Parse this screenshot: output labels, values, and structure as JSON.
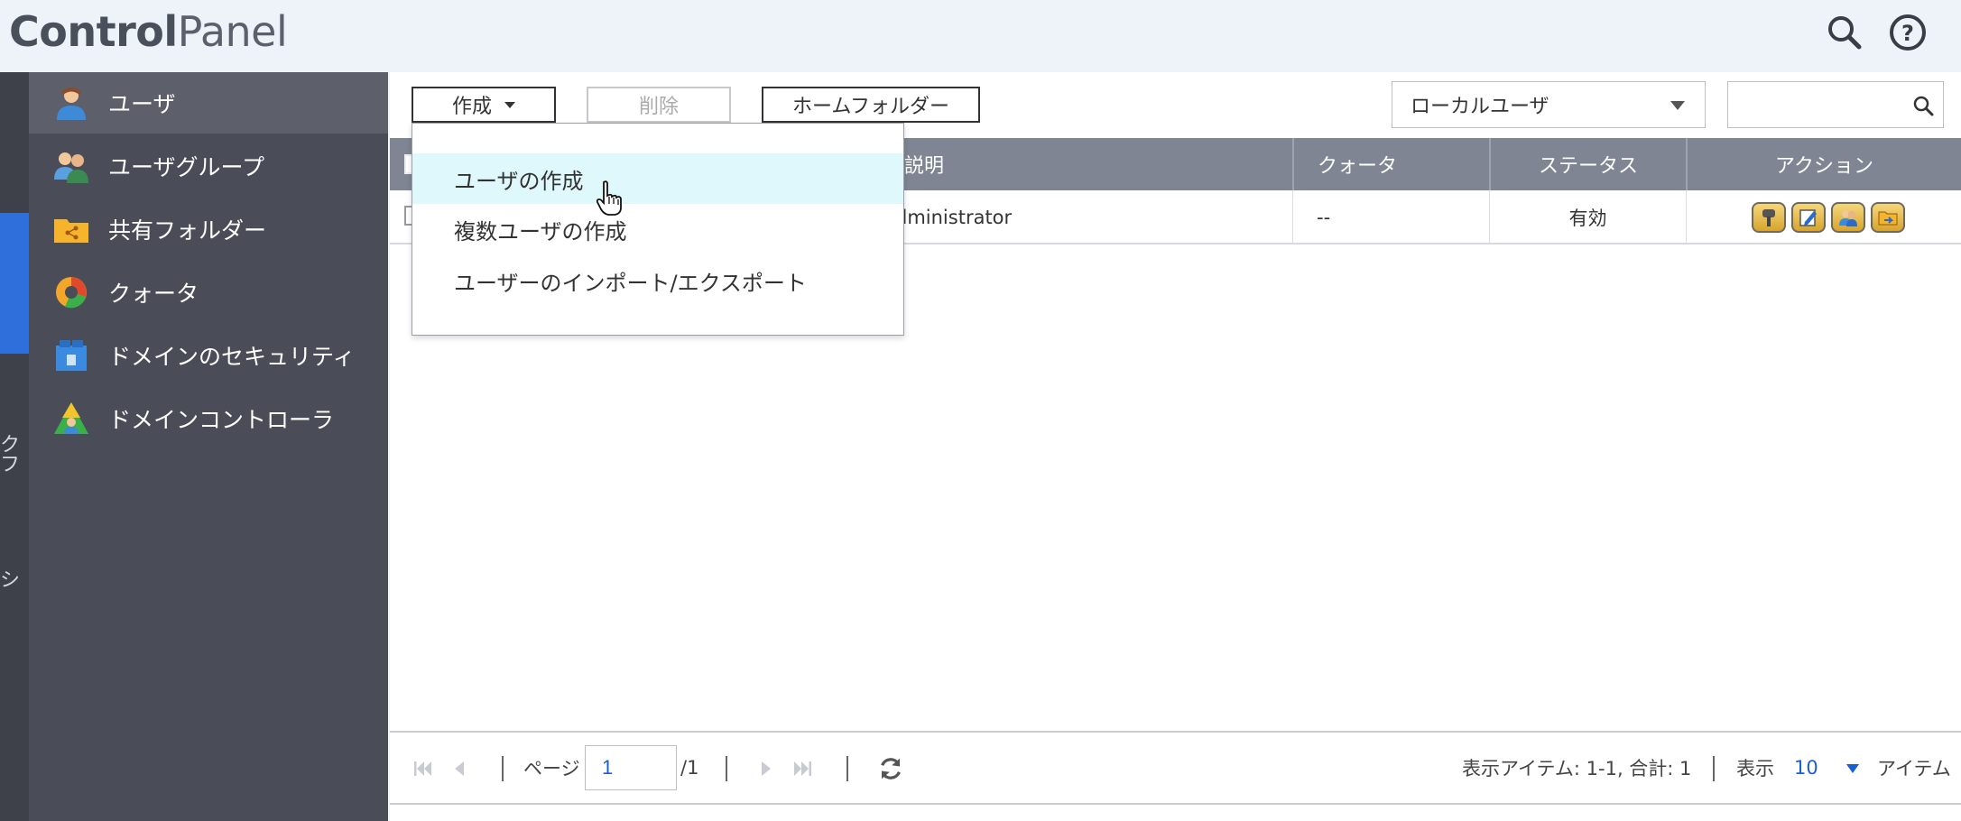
{
  "header": {
    "title_bold": "Control",
    "title_light": "Panel",
    "search_icon": "search-icon",
    "help_icon": "help-icon"
  },
  "rail": {
    "texts": [
      "ク",
      "フ",
      "シ"
    ]
  },
  "sidebar": {
    "items": [
      {
        "label": "ユーザ",
        "icon": "user-icon",
        "active": true
      },
      {
        "label": "ユーザグループ",
        "icon": "user-group-icon",
        "active": false
      },
      {
        "label": "共有フォルダー",
        "icon": "shared-folder-icon",
        "active": false
      },
      {
        "label": "クォータ",
        "icon": "quota-icon",
        "active": false
      },
      {
        "label": "ドメインのセキュリティ",
        "icon": "domain-security-icon",
        "active": false
      },
      {
        "label": "ドメインコントローラ",
        "icon": "domain-controller-icon",
        "active": false
      }
    ]
  },
  "toolbar": {
    "create_label": "作成",
    "delete_label": "削除",
    "home_folder_label": "ホームフォルダー",
    "user_type_selected": "ローカルユーザ",
    "search_placeholder": ""
  },
  "dropdown": {
    "items": [
      {
        "label": "ユーザの作成",
        "hovered": true
      },
      {
        "label": "複数ユーザの作成",
        "hovered": false
      },
      {
        "label": "ユーザーのインポート/エクスポート",
        "hovered": false
      }
    ]
  },
  "table": {
    "columns": [
      "説明",
      "クォータ",
      "ステータス",
      "アクション"
    ],
    "rows": [
      {
        "description": "dministrator",
        "quota": "--",
        "status": "有効",
        "actions": [
          "password-key-icon",
          "edit-icon",
          "user-group-edit-icon",
          "shared-folder-permission-icon"
        ]
      }
    ]
  },
  "pager": {
    "page_label": "ページ",
    "page_value": "1",
    "page_total": "/1",
    "items_summary": "表示アイテム: 1-1, 合計: 1",
    "display_label": "表示",
    "per_page_value": "10",
    "items_label": "アイテム"
  },
  "colors": {
    "sidebar_bg": "#4a4d57",
    "sidebar_active": "#5d606b",
    "table_header": "#7f8593",
    "accent_blue": "#2f6fdc",
    "dropdown_hover": "#dff8fb"
  }
}
